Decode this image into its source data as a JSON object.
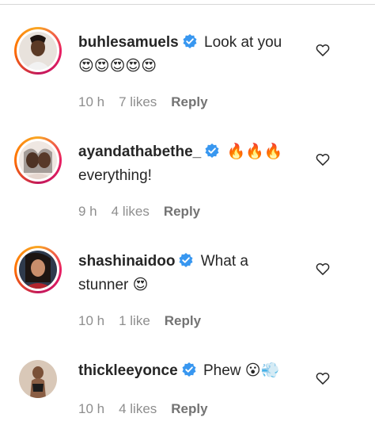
{
  "comments": [
    {
      "username": "buhlesamuels",
      "text": "Look at you",
      "emoji": "😍😍😍😍😍",
      "time": "10 h",
      "likes": "7 likes",
      "reply": "Reply"
    },
    {
      "username": "ayandathabethe_",
      "text": "everything!",
      "emoji": "🔥🔥🔥",
      "time": "9 h",
      "likes": "4 likes",
      "reply": "Reply"
    },
    {
      "username": "shashinaidoo",
      "text_a": "What a",
      "text_b": "stunner",
      "emoji": "😍",
      "time": "10 h",
      "likes": "1 like",
      "reply": "Reply"
    },
    {
      "username": "thickleeyonce",
      "text": "Phew",
      "emoji": "😮💨",
      "time": "10 h",
      "likes": "4 likes",
      "reply": "Reply"
    }
  ],
  "colors": {
    "text": "#262626",
    "meta": "#8e8e8e",
    "verified": "#3897f0",
    "story_ring": "#e91e63"
  },
  "icons": {
    "like": "heart-outline-icon",
    "verified": "verified-badge-icon"
  }
}
